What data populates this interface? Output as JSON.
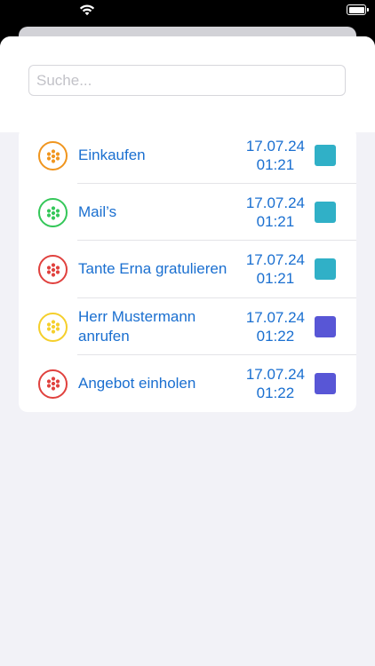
{
  "status_bar": {
    "wifi_icon": "wifi-icon",
    "battery_icon": "battery-icon"
  },
  "search": {
    "placeholder": "Suche...",
    "value": ""
  },
  "tasks": [
    {
      "title": "Einkaufen",
      "date": "17.07.24",
      "time": "01:21",
      "status_color": "#F0951E",
      "swatch_color": "#30B0C7",
      "icon": "dots-circle-icon"
    },
    {
      "title": "Mail’s",
      "date": "17.07.24",
      "time": "01:21",
      "status_color": "#34C759",
      "swatch_color": "#30B0C7",
      "icon": "dots-circle-icon"
    },
    {
      "title": "Tante Erna gratulieren",
      "date": "17.07.24",
      "time": "01:21",
      "status_color": "#E0413E",
      "swatch_color": "#30B0C7",
      "icon": "dots-circle-icon"
    },
    {
      "title": "Herr Mustermann anrufen",
      "date": "17.07.24",
      "time": "01:22",
      "status_color": "#F5CF2B",
      "swatch_color": "#5856D6",
      "icon": "dots-circle-icon"
    },
    {
      "title": "Angebot einholen",
      "date": "17.07.24",
      "time": "01:22",
      "status_color": "#E0413E",
      "swatch_color": "#5856D6",
      "icon": "dots-circle-icon"
    }
  ]
}
